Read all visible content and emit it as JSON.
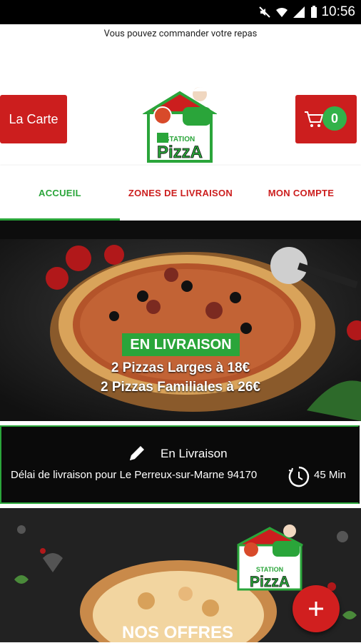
{
  "status_bar": {
    "time": "10:56"
  },
  "marquee": {
    "text": "Vous pouvez commander votre repas"
  },
  "header": {
    "menu_button_label": "La Carte",
    "cart_count": "0",
    "logo_line1": "STATION",
    "logo_line2": "PizzA"
  },
  "tabs": [
    {
      "label": "ACCUEIL",
      "active": true
    },
    {
      "label": "ZONES DE LIVRAISON",
      "active": false
    },
    {
      "label": "MON COMPTE",
      "active": false
    }
  ],
  "banner": {
    "pill": "EN LIVRAISON",
    "line1": "2 Pizzas Larges à 18€",
    "line2": "2 Pizzas Familiales à 26€"
  },
  "delivery": {
    "title": "En Livraison",
    "text": "Délai de livraison pour Le Perreux-sur-Marne 94170",
    "time": "45 Min"
  },
  "offers": {
    "title": "NOS OFFRES",
    "logo_line1": "STATION",
    "logo_line2": "PizzA"
  },
  "colors": {
    "brand_red": "#cc1e1e",
    "brand_green": "#2aa53a"
  },
  "icons": {
    "cart": "cart-icon",
    "edit": "pencil-icon",
    "timer": "timer-icon",
    "fab": "plus-icon"
  }
}
